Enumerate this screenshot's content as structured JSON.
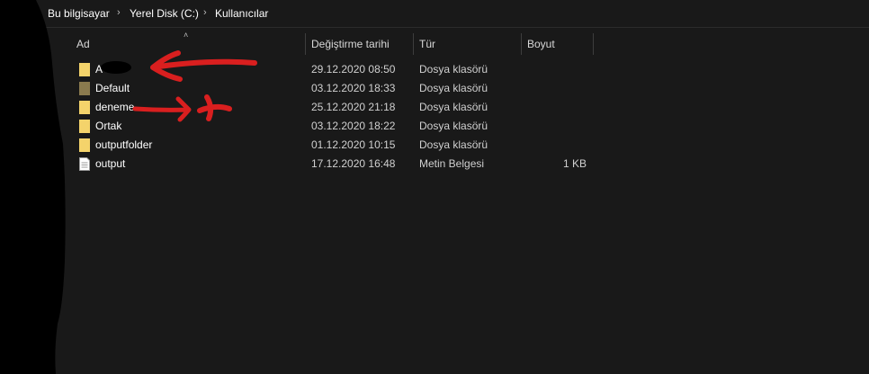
{
  "breadcrumb": {
    "items": [
      "Bu bilgisayar",
      "Yerel Disk (C:)",
      "Kullanıcılar"
    ]
  },
  "columns": {
    "name": "Ad",
    "date": "Değiştirme tarihi",
    "type": "Tür",
    "size": "Boyut"
  },
  "rows": [
    {
      "name": "A",
      "date": "29.12.2020 08:50",
      "type": "Dosya klasörü",
      "size": "",
      "icon": "folder-icon"
    },
    {
      "name": "Default",
      "date": "03.12.2020 18:33",
      "type": "Dosya klasörü",
      "size": "",
      "icon": "folder-icon"
    },
    {
      "name": "deneme",
      "date": "25.12.2020 21:18",
      "type": "Dosya klasörü",
      "size": "",
      "icon": "folder-icon"
    },
    {
      "name": "Ortak",
      "date": "03.12.2020 18:22",
      "type": "Dosya klasörü",
      "size": "",
      "icon": "folder-icon"
    },
    {
      "name": "outputfolder",
      "date": "01.12.2020 10:15",
      "type": "Dosya klasörü",
      "size": "",
      "icon": "folder-icon"
    },
    {
      "name": "output",
      "date": "17.12.2020 16:48",
      "type": "Metin Belgesi",
      "size": "1 KB",
      "icon": "text-file-icon"
    }
  ],
  "colors": {
    "background": "#191919",
    "folder": "#f4d36b",
    "folder_dim": "#8a7a4e",
    "annotation": "#d91f1f"
  }
}
